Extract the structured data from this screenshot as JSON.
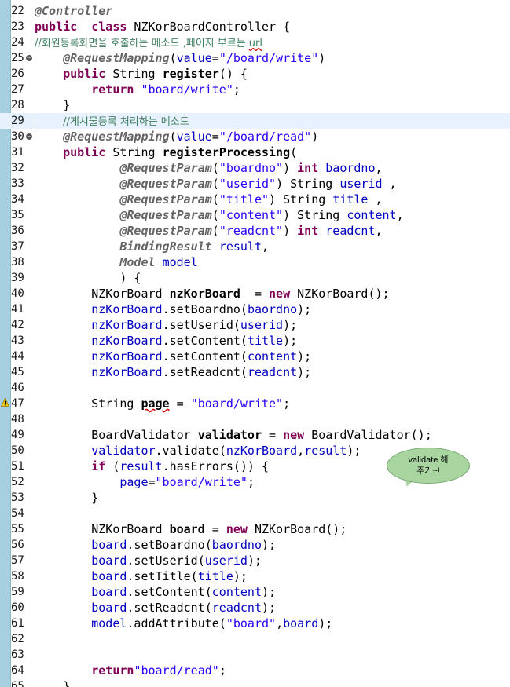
{
  "editor": {
    "lines": [
      {
        "n": "22",
        "tokens": [
          [
            "ann",
            "@Controller"
          ]
        ]
      },
      {
        "n": "23",
        "tokens": [
          [
            "kw",
            "public"
          ],
          [
            "",
            "  "
          ],
          [
            "kw",
            "class"
          ],
          [
            "",
            " NZKorBoardController {"
          ]
        ]
      },
      {
        "n": "24",
        "tokens": [
          [
            "cmt",
            "//회원등록화면을 호출하는 메소드 ,페이지 부르는 "
          ],
          [
            "cmt squig",
            "url"
          ]
        ]
      },
      {
        "n": "25",
        "fold": true,
        "tokens": [
          [
            "",
            "    "
          ],
          [
            "ann",
            "@RequestMapping"
          ],
          [
            "",
            "("
          ],
          [
            "fld",
            "value"
          ],
          [
            "",
            "="
          ],
          [
            "str",
            "\"/board/write\""
          ],
          [
            "",
            ")"
          ]
        ]
      },
      {
        "n": "26",
        "tokens": [
          [
            "",
            "    "
          ],
          [
            "kw",
            "public"
          ],
          [
            "",
            " String "
          ],
          [
            "bold",
            "register"
          ],
          [
            "",
            "() {"
          ]
        ]
      },
      {
        "n": "27",
        "tokens": [
          [
            "",
            "        "
          ],
          [
            "kw",
            "return"
          ],
          [
            "",
            " "
          ],
          [
            "str",
            "\"board/write\""
          ],
          [
            "",
            ";"
          ]
        ]
      },
      {
        "n": "28",
        "tokens": [
          [
            "",
            "    }"
          ]
        ]
      },
      {
        "n": "29",
        "current": true,
        "caret": true,
        "tokens": [
          [
            "",
            "    "
          ],
          [
            "cmt",
            "//게시물등록 처리하는 메소드"
          ]
        ]
      },
      {
        "n": "30",
        "fold": true,
        "tokens": [
          [
            "",
            "    "
          ],
          [
            "ann",
            "@RequestMapping"
          ],
          [
            "",
            "("
          ],
          [
            "fld",
            "value"
          ],
          [
            "",
            "="
          ],
          [
            "str",
            "\"/board/read\""
          ],
          [
            "",
            ")"
          ]
        ]
      },
      {
        "n": "31",
        "tokens": [
          [
            "",
            "    "
          ],
          [
            "kw",
            "public"
          ],
          [
            "",
            " String "
          ],
          [
            "bold",
            "registerProcessing"
          ],
          [
            "",
            "("
          ]
        ]
      },
      {
        "n": "32",
        "tokens": [
          [
            "",
            "            "
          ],
          [
            "ann",
            "@RequestParam"
          ],
          [
            "",
            "("
          ],
          [
            "str",
            "\"boardno\""
          ],
          [
            "",
            ") "
          ],
          [
            "kw",
            "int"
          ],
          [
            "",
            " "
          ],
          [
            "fld",
            "baordno"
          ],
          [
            "",
            ","
          ]
        ]
      },
      {
        "n": "33",
        "tokens": [
          [
            "",
            "            "
          ],
          [
            "ann",
            "@RequestParam"
          ],
          [
            "",
            "("
          ],
          [
            "str",
            "\"userid\""
          ],
          [
            "",
            ") String "
          ],
          [
            "fld",
            "userid"
          ],
          [
            "",
            " ,"
          ]
        ]
      },
      {
        "n": "34",
        "tokens": [
          [
            "",
            "            "
          ],
          [
            "ann",
            "@RequestParam"
          ],
          [
            "",
            "("
          ],
          [
            "str",
            "\"title\""
          ],
          [
            "",
            ") String "
          ],
          [
            "fld",
            "title"
          ],
          [
            "",
            " ,"
          ]
        ]
      },
      {
        "n": "35",
        "tokens": [
          [
            "",
            "            "
          ],
          [
            "ann",
            "@RequestParam"
          ],
          [
            "",
            "("
          ],
          [
            "str",
            "\"content\""
          ],
          [
            "",
            ") String "
          ],
          [
            "fld",
            "content"
          ],
          [
            "",
            ","
          ]
        ]
      },
      {
        "n": "36",
        "tokens": [
          [
            "",
            "            "
          ],
          [
            "ann",
            "@RequestParam"
          ],
          [
            "",
            "("
          ],
          [
            "str",
            "\"readcnt\""
          ],
          [
            "",
            ") "
          ],
          [
            "kw",
            "int"
          ],
          [
            "",
            " "
          ],
          [
            "fld",
            "readcnt"
          ],
          [
            "",
            ","
          ]
        ]
      },
      {
        "n": "37",
        "tokens": [
          [
            "",
            "            "
          ],
          [
            "kwtype",
            "BindingResult"
          ],
          [
            "",
            " "
          ],
          [
            "fld",
            "result"
          ],
          [
            "",
            ","
          ]
        ]
      },
      {
        "n": "38",
        "tokens": [
          [
            "",
            "            "
          ],
          [
            "kwtype",
            "Model"
          ],
          [
            "",
            " "
          ],
          [
            "fld",
            "model"
          ]
        ]
      },
      {
        "n": "39",
        "tokens": [
          [
            "",
            "            ) {"
          ]
        ]
      },
      {
        "n": "40",
        "tokens": [
          [
            "",
            "        NZKorBoard "
          ],
          [
            "bold",
            "nzKorBoard"
          ],
          [
            "",
            "  = "
          ],
          [
            "kw",
            "new"
          ],
          [
            "",
            " NZKorBoard();"
          ]
        ]
      },
      {
        "n": "41",
        "tokens": [
          [
            "",
            "        "
          ],
          [
            "fld",
            "nzKorBoard"
          ],
          [
            "",
            ".setBoardno("
          ],
          [
            "fld",
            "baordno"
          ],
          [
            "",
            ");"
          ]
        ]
      },
      {
        "n": "42",
        "tokens": [
          [
            "",
            "        "
          ],
          [
            "fld",
            "nzKorBoard"
          ],
          [
            "",
            ".setUserid("
          ],
          [
            "fld",
            "userid"
          ],
          [
            "",
            ");"
          ]
        ]
      },
      {
        "n": "43",
        "tokens": [
          [
            "",
            "        "
          ],
          [
            "fld",
            "nzKorBoard"
          ],
          [
            "",
            ".setContent("
          ],
          [
            "fld",
            "title"
          ],
          [
            "",
            ");"
          ]
        ]
      },
      {
        "n": "44",
        "tokens": [
          [
            "",
            "        "
          ],
          [
            "fld",
            "nzKorBoard"
          ],
          [
            "",
            ".setContent("
          ],
          [
            "fld",
            "content"
          ],
          [
            "",
            ");"
          ]
        ]
      },
      {
        "n": "45",
        "tokens": [
          [
            "",
            "        "
          ],
          [
            "fld",
            "nzKorBoard"
          ],
          [
            "",
            ".setReadcnt("
          ],
          [
            "fld",
            "readcnt"
          ],
          [
            "",
            ");"
          ]
        ]
      },
      {
        "n": "46",
        "tokens": []
      },
      {
        "n": "47",
        "warn": true,
        "tokens": [
          [
            "",
            "        String "
          ],
          [
            "bold squig",
            "page"
          ],
          [
            "",
            " = "
          ],
          [
            "str",
            "\"board/write\""
          ],
          [
            "",
            ";"
          ]
        ]
      },
      {
        "n": "48",
        "tokens": []
      },
      {
        "n": "49",
        "tokens": [
          [
            "",
            "        BoardValidator "
          ],
          [
            "bold",
            "validator"
          ],
          [
            "",
            " = "
          ],
          [
            "kw",
            "new"
          ],
          [
            "",
            " BoardValidator();"
          ]
        ]
      },
      {
        "n": "50",
        "tokens": [
          [
            "",
            "        "
          ],
          [
            "fld",
            "validator"
          ],
          [
            "",
            ".validate("
          ],
          [
            "fld",
            "nzKorBoard"
          ],
          [
            "",
            ","
          ],
          [
            "fld",
            "result"
          ],
          [
            "",
            ");"
          ]
        ]
      },
      {
        "n": "51",
        "tokens": [
          [
            "",
            "        "
          ],
          [
            "kw",
            "if"
          ],
          [
            "",
            " ("
          ],
          [
            "fld",
            "result"
          ],
          [
            "",
            ".hasErrors()) {"
          ]
        ]
      },
      {
        "n": "52",
        "tokens": [
          [
            "",
            "            "
          ],
          [
            "fld",
            "page"
          ],
          [
            "",
            "="
          ],
          [
            "str",
            "\"board/write\""
          ],
          [
            "",
            ";"
          ]
        ]
      },
      {
        "n": "53",
        "tokens": [
          [
            "",
            "        }"
          ]
        ]
      },
      {
        "n": "54",
        "tokens": []
      },
      {
        "n": "55",
        "tokens": [
          [
            "",
            "        NZKorBoard "
          ],
          [
            "bold",
            "board"
          ],
          [
            "",
            " = "
          ],
          [
            "kw",
            "new"
          ],
          [
            "",
            " NZKorBoard();"
          ]
        ]
      },
      {
        "n": "56",
        "tokens": [
          [
            "",
            "        "
          ],
          [
            "fld",
            "board"
          ],
          [
            "",
            ".setBoardno("
          ],
          [
            "fld",
            "baordno"
          ],
          [
            "",
            ");"
          ]
        ]
      },
      {
        "n": "57",
        "tokens": [
          [
            "",
            "        "
          ],
          [
            "fld",
            "board"
          ],
          [
            "",
            ".setUserid("
          ],
          [
            "fld",
            "userid"
          ],
          [
            "",
            ");"
          ]
        ]
      },
      {
        "n": "58",
        "tokens": [
          [
            "",
            "        "
          ],
          [
            "fld",
            "board"
          ],
          [
            "",
            ".setTitle("
          ],
          [
            "fld",
            "title"
          ],
          [
            "",
            ");"
          ]
        ]
      },
      {
        "n": "59",
        "tokens": [
          [
            "",
            "        "
          ],
          [
            "fld",
            "board"
          ],
          [
            "",
            ".setContent("
          ],
          [
            "fld",
            "content"
          ],
          [
            "",
            ");"
          ]
        ]
      },
      {
        "n": "60",
        "tokens": [
          [
            "",
            "        "
          ],
          [
            "fld",
            "board"
          ],
          [
            "",
            ".setReadcnt("
          ],
          [
            "fld",
            "readcnt"
          ],
          [
            "",
            ");"
          ]
        ]
      },
      {
        "n": "61",
        "tokens": [
          [
            "",
            "        "
          ],
          [
            "fld",
            "model"
          ],
          [
            "",
            ".addAttribute("
          ],
          [
            "str",
            "\"board\""
          ],
          [
            "",
            ","
          ],
          [
            "fld",
            "board"
          ],
          [
            "",
            ");"
          ]
        ]
      },
      {
        "n": "62",
        "tokens": []
      },
      {
        "n": "63",
        "tokens": []
      },
      {
        "n": "64",
        "tokens": [
          [
            "",
            "        "
          ],
          [
            "kw",
            "return"
          ],
          [
            "str",
            "\"board/read\""
          ],
          [
            "",
            ";"
          ]
        ]
      },
      {
        "n": "65",
        "tokens": [
          [
            "",
            "    }"
          ]
        ]
      }
    ]
  },
  "bubble": {
    "text": "validate 해\n주기~!"
  },
  "colors": {
    "keyword": "#7f0055",
    "annotation": "#646464",
    "string": "#2a00ff",
    "field": "#0000c0",
    "comment": "#3f7f5f",
    "ruler": "#a6cfe0",
    "bubble": "#a8d5a0"
  }
}
